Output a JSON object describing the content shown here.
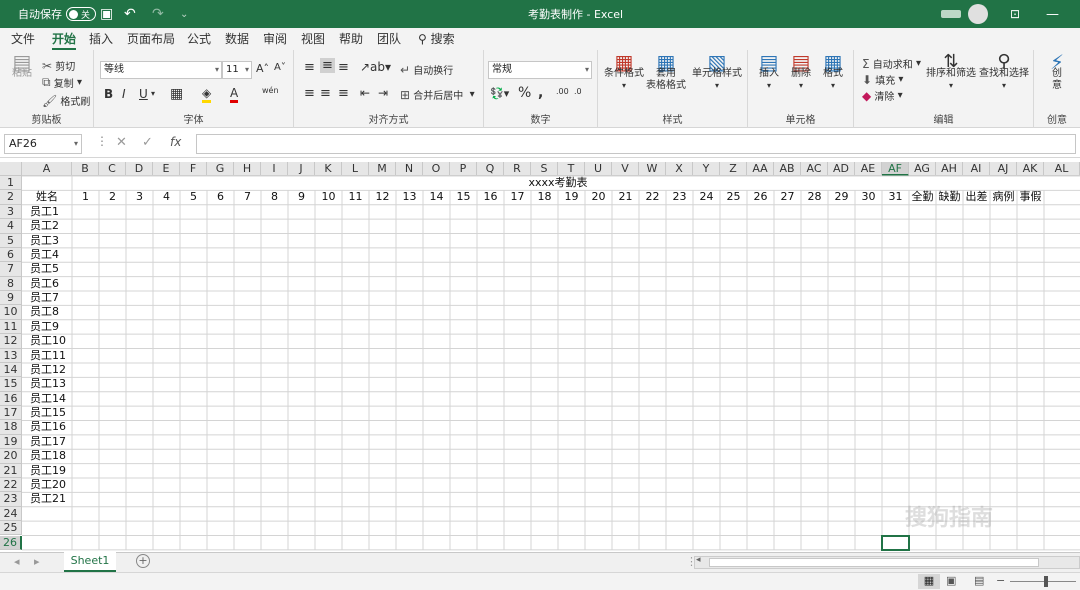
{
  "titlebar": {
    "autosave_label": "自动保存",
    "autosave_state": "关",
    "doc_title": "考勤表制作 - Excel"
  },
  "tabs": [
    "文件",
    "开始",
    "插入",
    "页面布局",
    "公式",
    "数据",
    "审阅",
    "视图",
    "帮助",
    "团队"
  ],
  "tell_me": "搜索",
  "ribbon": {
    "clipboard": {
      "label": "剪贴板",
      "paste": "粘贴",
      "cut": "剪切",
      "copy": "复制",
      "format_painter": "格式刷"
    },
    "font": {
      "label": "字体",
      "font_name": "等线",
      "font_size": "11",
      "bold": "B",
      "italic": "I",
      "underline": "U"
    },
    "alignment": {
      "label": "对齐方式",
      "wrap": "自动换行",
      "merge": "合并后居中"
    },
    "number": {
      "label": "数字",
      "format": "常规"
    },
    "styles": {
      "label": "样式",
      "conditional": "条件格式",
      "table_l1": "套用",
      "table_l2": "表格格式",
      "cell_styles": "单元格样式"
    },
    "cells": {
      "label": "单元格",
      "insert": "插入",
      "delete": "删除",
      "format": "格式"
    },
    "editing": {
      "label": "编辑",
      "autosum": "自动求和",
      "fill": "填充",
      "clear": "清除",
      "sort": "排序和筛选",
      "find": "查找和选择"
    },
    "creative": {
      "label": "创意",
      "btn_l1": "创",
      "btn_l2": "意"
    }
  },
  "formula_bar": {
    "name_box": "AF26",
    "fx": "fx",
    "value": ""
  },
  "columns": [
    "A",
    "B",
    "C",
    "D",
    "E",
    "F",
    "G",
    "H",
    "I",
    "J",
    "K",
    "L",
    "M",
    "N",
    "O",
    "P",
    "Q",
    "R",
    "S",
    "T",
    "U",
    "V",
    "W",
    "X",
    "Y",
    "Z",
    "AA",
    "AB",
    "AC",
    "AD",
    "AE",
    "AF",
    "AG",
    "AH",
    "AI",
    "AJ",
    "AK",
    "AL"
  ],
  "rows": [
    "1",
    "2",
    "3",
    "4",
    "5",
    "6",
    "7",
    "8",
    "9",
    "10",
    "11",
    "12",
    "13",
    "14",
    "15",
    "16",
    "17",
    "18",
    "19",
    "20",
    "21",
    "22",
    "23",
    "24",
    "25",
    "26"
  ],
  "sheet": {
    "title": "xxxx考勤表",
    "name_header": "姓名",
    "days": [
      "1",
      "2",
      "3",
      "4",
      "5",
      "6",
      "7",
      "8",
      "9",
      "10",
      "11",
      "12",
      "13",
      "14",
      "15",
      "16",
      "17",
      "18",
      "19",
      "20",
      "21",
      "22",
      "23",
      "24",
      "25",
      "26",
      "27",
      "28",
      "29",
      "30",
      "31"
    ],
    "summary_headers": [
      "全勤",
      "缺勤",
      "出差",
      "病例",
      "事假"
    ],
    "employees": [
      "员工1",
      "员工2",
      "员工3",
      "员工4",
      "员工5",
      "员工6",
      "员工7",
      "员工8",
      "员工9",
      "员工10",
      "员工11",
      "员工12",
      "员工13",
      "员工14",
      "员工15",
      "员工16",
      "员工17",
      "员工18",
      "员工19",
      "员工20",
      "员工21"
    ]
  },
  "sheet_tabs": [
    "Sheet1"
  ],
  "watermark": "搜狗指南",
  "colors": {
    "brand": "#217346",
    "grid": "#d4d4d4",
    "header": "#e6e6e6"
  }
}
